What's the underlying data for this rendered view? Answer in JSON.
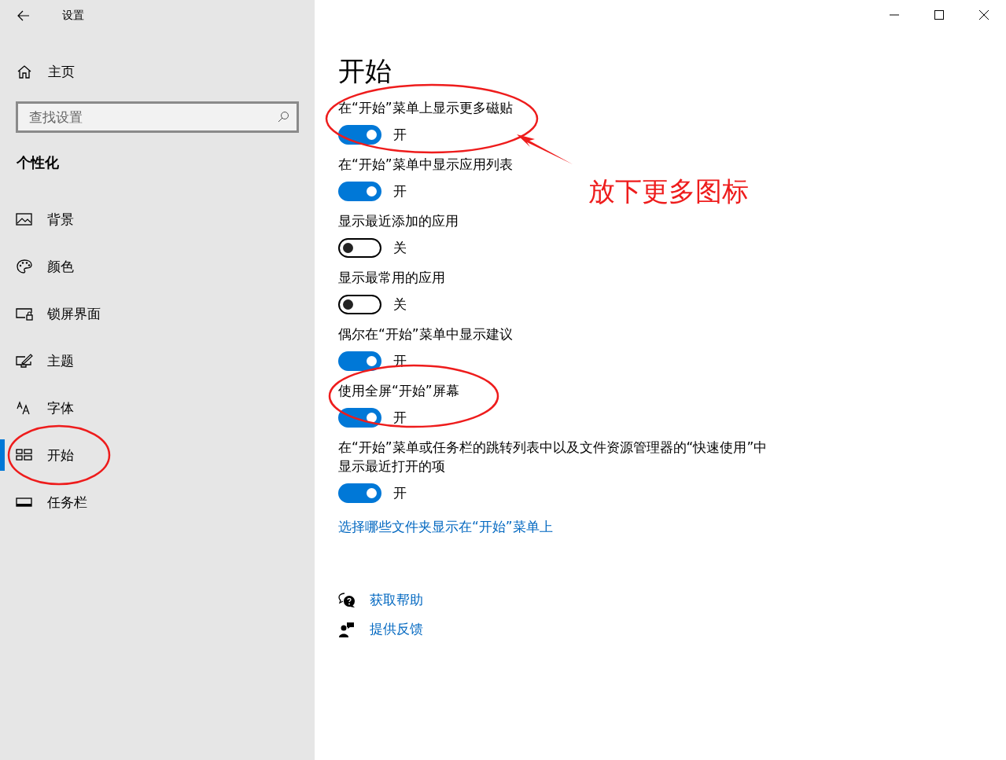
{
  "window": {
    "title": "设置"
  },
  "sidebar": {
    "home": "主页",
    "search": {
      "placeholder": "查找设置"
    },
    "section": "个性化",
    "items": [
      {
        "label": "背景",
        "kind": "image",
        "selected": false,
        "circled": false
      },
      {
        "label": "颜色",
        "kind": "palette",
        "selected": false,
        "circled": false
      },
      {
        "label": "锁屏界面",
        "kind": "lock",
        "selected": false,
        "circled": false
      },
      {
        "label": "主题",
        "kind": "theme",
        "selected": false,
        "circled": false
      },
      {
        "label": "字体",
        "kind": "font",
        "selected": false,
        "circled": false
      },
      {
        "label": "开始",
        "kind": "start",
        "selected": true,
        "circled": true
      },
      {
        "label": "任务栏",
        "kind": "taskbar",
        "selected": false,
        "circled": false
      }
    ]
  },
  "page": {
    "title": "开始",
    "settings": [
      {
        "label": "在“开始”菜单上显示更多磁贴",
        "on": true,
        "state": "开",
        "circled": true,
        "note": "放下更多图标"
      },
      {
        "label": "在“开始”菜单中显示应用列表",
        "on": true,
        "state": "开",
        "circled": false
      },
      {
        "label": "显示最近添加的应用",
        "on": false,
        "state": "关",
        "circled": false
      },
      {
        "label": "显示最常用的应用",
        "on": false,
        "state": "关",
        "circled": false
      },
      {
        "label": "偶尔在“开始”菜单中显示建议",
        "on": true,
        "state": "开",
        "circled": false
      },
      {
        "label": "使用全屏“开始”屏幕",
        "on": true,
        "state": "开",
        "circled": true
      },
      {
        "label": "在“开始”菜单或任务栏的跳转列表中以及文件资源管理器的“快速使用”中显示最近打开的项",
        "on": true,
        "state": "开",
        "circled": false
      }
    ],
    "link": "选择哪些文件夹显示在“开始”菜单上",
    "help": [
      {
        "label": "获取帮助",
        "kind": "help"
      },
      {
        "label": "提供反馈",
        "kind": "feedback"
      }
    ]
  }
}
